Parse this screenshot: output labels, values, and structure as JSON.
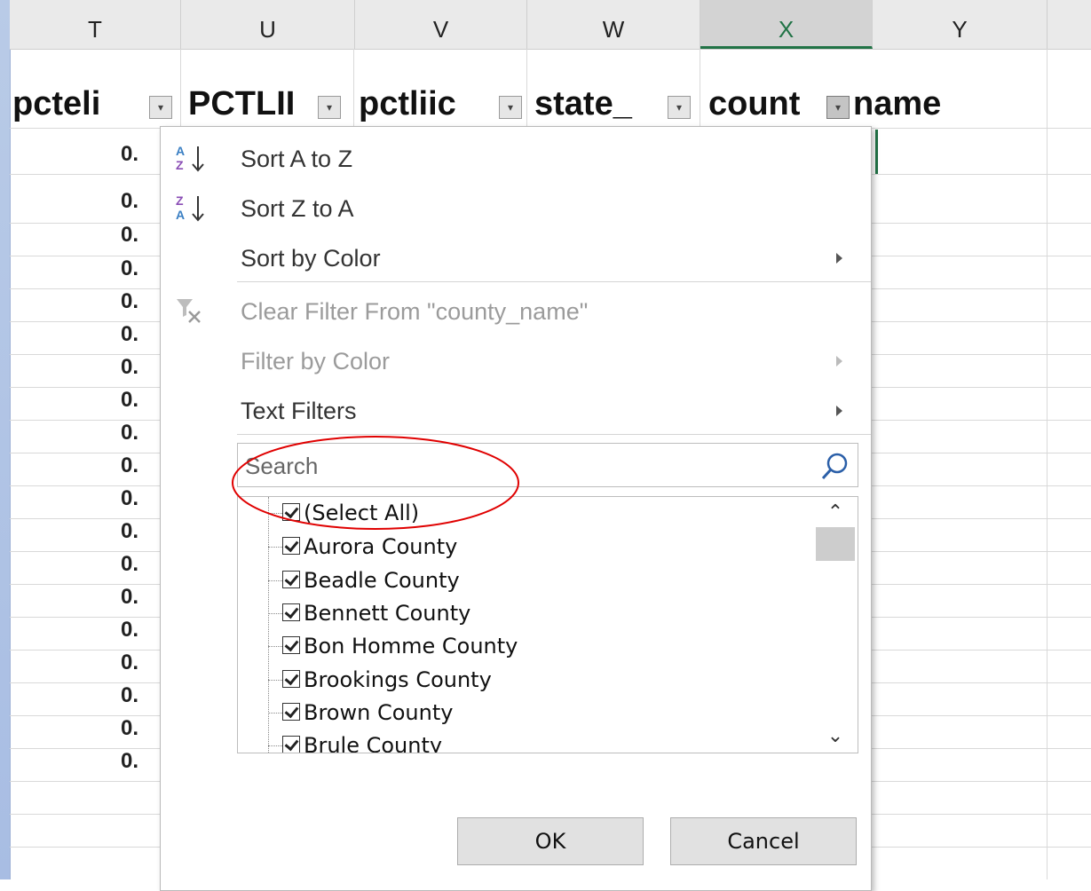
{
  "columns": [
    "T",
    "U",
    "V",
    "W",
    "X",
    "Y"
  ],
  "header_labels": [
    "pcteli",
    "PCTLII",
    "pctliic",
    "state_",
    "count",
    "name"
  ],
  "row_values": [
    "0.",
    "0.",
    "0.",
    "0.",
    "0.",
    "0.",
    "0.",
    "0.",
    "0.",
    "0.",
    "0.",
    "0.",
    "0.",
    "0.",
    "0.",
    "0.",
    "0.",
    "0.",
    "0."
  ],
  "menu": {
    "sort_az": "Sort A to Z",
    "sort_za": "Sort Z to A",
    "sort_by_color": "Sort by Color",
    "clear_filter": "Clear Filter From \"county_name\"",
    "filter_by_color": "Filter by Color",
    "text_filters": "Text Filters"
  },
  "search": {
    "placeholder": "Search"
  },
  "list_items": [
    "(Select All)",
    "Aurora County",
    "Beadle County",
    "Bennett County",
    "Bon Homme County",
    "Brookings County",
    "Brown County",
    "Brule County"
  ],
  "buttons": {
    "ok": "OK",
    "cancel": "Cancel"
  },
  "colors": {
    "accent": "#217346",
    "annotation": "#e00000"
  }
}
